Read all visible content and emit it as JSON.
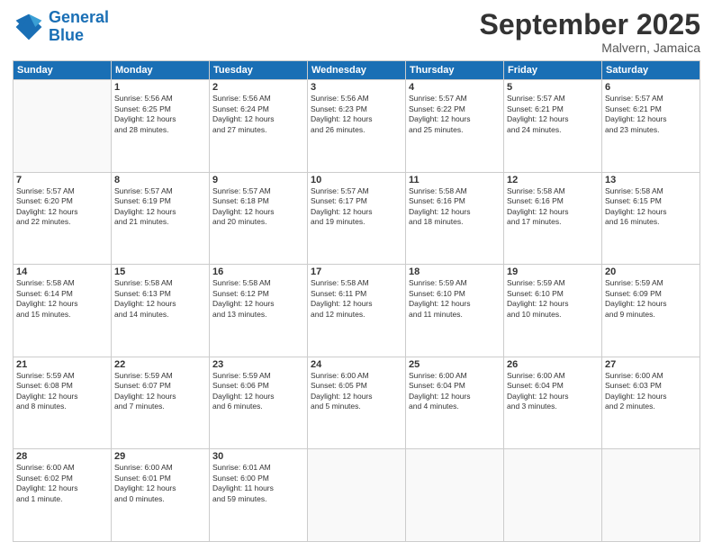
{
  "logo": {
    "line1": "General",
    "line2": "Blue"
  },
  "title": "September 2025",
  "subtitle": "Malvern, Jamaica",
  "days_header": [
    "Sunday",
    "Monday",
    "Tuesday",
    "Wednesday",
    "Thursday",
    "Friday",
    "Saturday"
  ],
  "weeks": [
    [
      {
        "day": "",
        "info": ""
      },
      {
        "day": "1",
        "info": "Sunrise: 5:56 AM\nSunset: 6:25 PM\nDaylight: 12 hours\nand 28 minutes."
      },
      {
        "day": "2",
        "info": "Sunrise: 5:56 AM\nSunset: 6:24 PM\nDaylight: 12 hours\nand 27 minutes."
      },
      {
        "day": "3",
        "info": "Sunrise: 5:56 AM\nSunset: 6:23 PM\nDaylight: 12 hours\nand 26 minutes."
      },
      {
        "day": "4",
        "info": "Sunrise: 5:57 AM\nSunset: 6:22 PM\nDaylight: 12 hours\nand 25 minutes."
      },
      {
        "day": "5",
        "info": "Sunrise: 5:57 AM\nSunset: 6:21 PM\nDaylight: 12 hours\nand 24 minutes."
      },
      {
        "day": "6",
        "info": "Sunrise: 5:57 AM\nSunset: 6:21 PM\nDaylight: 12 hours\nand 23 minutes."
      }
    ],
    [
      {
        "day": "7",
        "info": "Sunrise: 5:57 AM\nSunset: 6:20 PM\nDaylight: 12 hours\nand 22 minutes."
      },
      {
        "day": "8",
        "info": "Sunrise: 5:57 AM\nSunset: 6:19 PM\nDaylight: 12 hours\nand 21 minutes."
      },
      {
        "day": "9",
        "info": "Sunrise: 5:57 AM\nSunset: 6:18 PM\nDaylight: 12 hours\nand 20 minutes."
      },
      {
        "day": "10",
        "info": "Sunrise: 5:57 AM\nSunset: 6:17 PM\nDaylight: 12 hours\nand 19 minutes."
      },
      {
        "day": "11",
        "info": "Sunrise: 5:58 AM\nSunset: 6:16 PM\nDaylight: 12 hours\nand 18 minutes."
      },
      {
        "day": "12",
        "info": "Sunrise: 5:58 AM\nSunset: 6:16 PM\nDaylight: 12 hours\nand 17 minutes."
      },
      {
        "day": "13",
        "info": "Sunrise: 5:58 AM\nSunset: 6:15 PM\nDaylight: 12 hours\nand 16 minutes."
      }
    ],
    [
      {
        "day": "14",
        "info": "Sunrise: 5:58 AM\nSunset: 6:14 PM\nDaylight: 12 hours\nand 15 minutes."
      },
      {
        "day": "15",
        "info": "Sunrise: 5:58 AM\nSunset: 6:13 PM\nDaylight: 12 hours\nand 14 minutes."
      },
      {
        "day": "16",
        "info": "Sunrise: 5:58 AM\nSunset: 6:12 PM\nDaylight: 12 hours\nand 13 minutes."
      },
      {
        "day": "17",
        "info": "Sunrise: 5:58 AM\nSunset: 6:11 PM\nDaylight: 12 hours\nand 12 minutes."
      },
      {
        "day": "18",
        "info": "Sunrise: 5:59 AM\nSunset: 6:10 PM\nDaylight: 12 hours\nand 11 minutes."
      },
      {
        "day": "19",
        "info": "Sunrise: 5:59 AM\nSunset: 6:10 PM\nDaylight: 12 hours\nand 10 minutes."
      },
      {
        "day": "20",
        "info": "Sunrise: 5:59 AM\nSunset: 6:09 PM\nDaylight: 12 hours\nand 9 minutes."
      }
    ],
    [
      {
        "day": "21",
        "info": "Sunrise: 5:59 AM\nSunset: 6:08 PM\nDaylight: 12 hours\nand 8 minutes."
      },
      {
        "day": "22",
        "info": "Sunrise: 5:59 AM\nSunset: 6:07 PM\nDaylight: 12 hours\nand 7 minutes."
      },
      {
        "day": "23",
        "info": "Sunrise: 5:59 AM\nSunset: 6:06 PM\nDaylight: 12 hours\nand 6 minutes."
      },
      {
        "day": "24",
        "info": "Sunrise: 6:00 AM\nSunset: 6:05 PM\nDaylight: 12 hours\nand 5 minutes."
      },
      {
        "day": "25",
        "info": "Sunrise: 6:00 AM\nSunset: 6:04 PM\nDaylight: 12 hours\nand 4 minutes."
      },
      {
        "day": "26",
        "info": "Sunrise: 6:00 AM\nSunset: 6:04 PM\nDaylight: 12 hours\nand 3 minutes."
      },
      {
        "day": "27",
        "info": "Sunrise: 6:00 AM\nSunset: 6:03 PM\nDaylight: 12 hours\nand 2 minutes."
      }
    ],
    [
      {
        "day": "28",
        "info": "Sunrise: 6:00 AM\nSunset: 6:02 PM\nDaylight: 12 hours\nand 1 minute."
      },
      {
        "day": "29",
        "info": "Sunrise: 6:00 AM\nSunset: 6:01 PM\nDaylight: 12 hours\nand 0 minutes."
      },
      {
        "day": "30",
        "info": "Sunrise: 6:01 AM\nSunset: 6:00 PM\nDaylight: 11 hours\nand 59 minutes."
      },
      {
        "day": "",
        "info": ""
      },
      {
        "day": "",
        "info": ""
      },
      {
        "day": "",
        "info": ""
      },
      {
        "day": "",
        "info": ""
      }
    ]
  ]
}
